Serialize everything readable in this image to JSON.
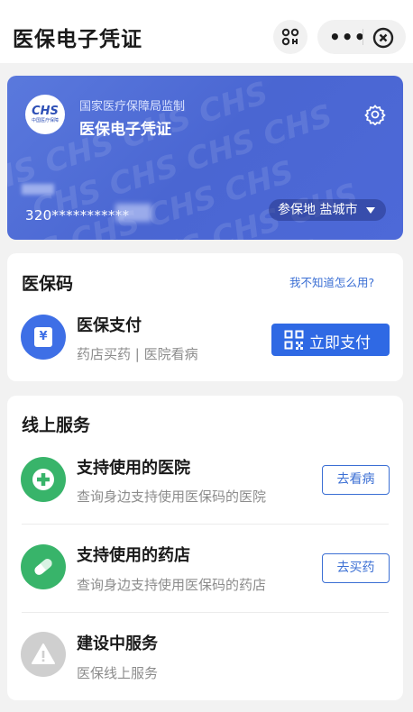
{
  "header": {
    "title": "医保电子凭证",
    "menu_dots": "•••"
  },
  "card": {
    "logo_big": "CHS",
    "logo_small": "中国医疗保障",
    "supervisor": "国家医疗保障局监制",
    "name": "医保电子凭证",
    "id_number": "320***********",
    "region_label": "参保地 盐城市",
    "watermark": "CHS CHS CHS CHS"
  },
  "medical_code": {
    "title": "医保码",
    "help_link": "我不知道怎么用?",
    "item": {
      "icon_glyph": "¥",
      "title": "医保支付",
      "subtitle": "药店买药 | 医院看病",
      "button": "立即支付"
    }
  },
  "online_services": {
    "title": "线上服务",
    "items": [
      {
        "title": "支持使用的医院",
        "subtitle": "查询身边支持使用医保码的医院",
        "button": "去看病",
        "icon": "hospital-cross-icon"
      },
      {
        "title": "支持使用的药店",
        "subtitle": "查询身边支持使用医保码的药店",
        "button": "去买药",
        "icon": "pill-icon"
      },
      {
        "title": "建设中服务",
        "subtitle": "医保线上服务",
        "icon": "warning-icon"
      }
    ]
  },
  "colors": {
    "accent": "#2f69e4",
    "card_bg": "#4d69d8",
    "green": "#38b46a",
    "gray_icon": "#cfcfcf"
  }
}
